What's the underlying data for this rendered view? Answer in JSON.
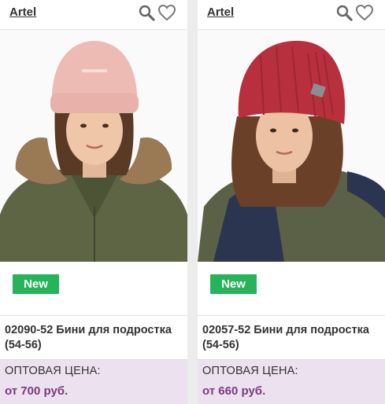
{
  "products": [
    {
      "brand": "Artel",
      "badge": "New",
      "name": "02090-52 Бини для подростка (54-56)",
      "price_label": "ОПТОВАЯ ЦЕНА:",
      "price": "от 700 руб.",
      "hat_color": "#eebbb4",
      "jacket_color": "#5d6545"
    },
    {
      "brand": "Artel",
      "badge": "New",
      "name": "02057-52 Бини для подростка (54-56)",
      "price_label": "ОПТОВАЯ ЦЕНА:",
      "price": "от 660 руб.",
      "hat_color": "#b8303d",
      "jacket_color": "#5b6146"
    }
  ],
  "icons": [
    "search-icon",
    "heart-icon"
  ],
  "colors": {
    "badge": "#27b35a",
    "price_bg": "#ece2ef",
    "price_text": "#7b3a7e"
  }
}
